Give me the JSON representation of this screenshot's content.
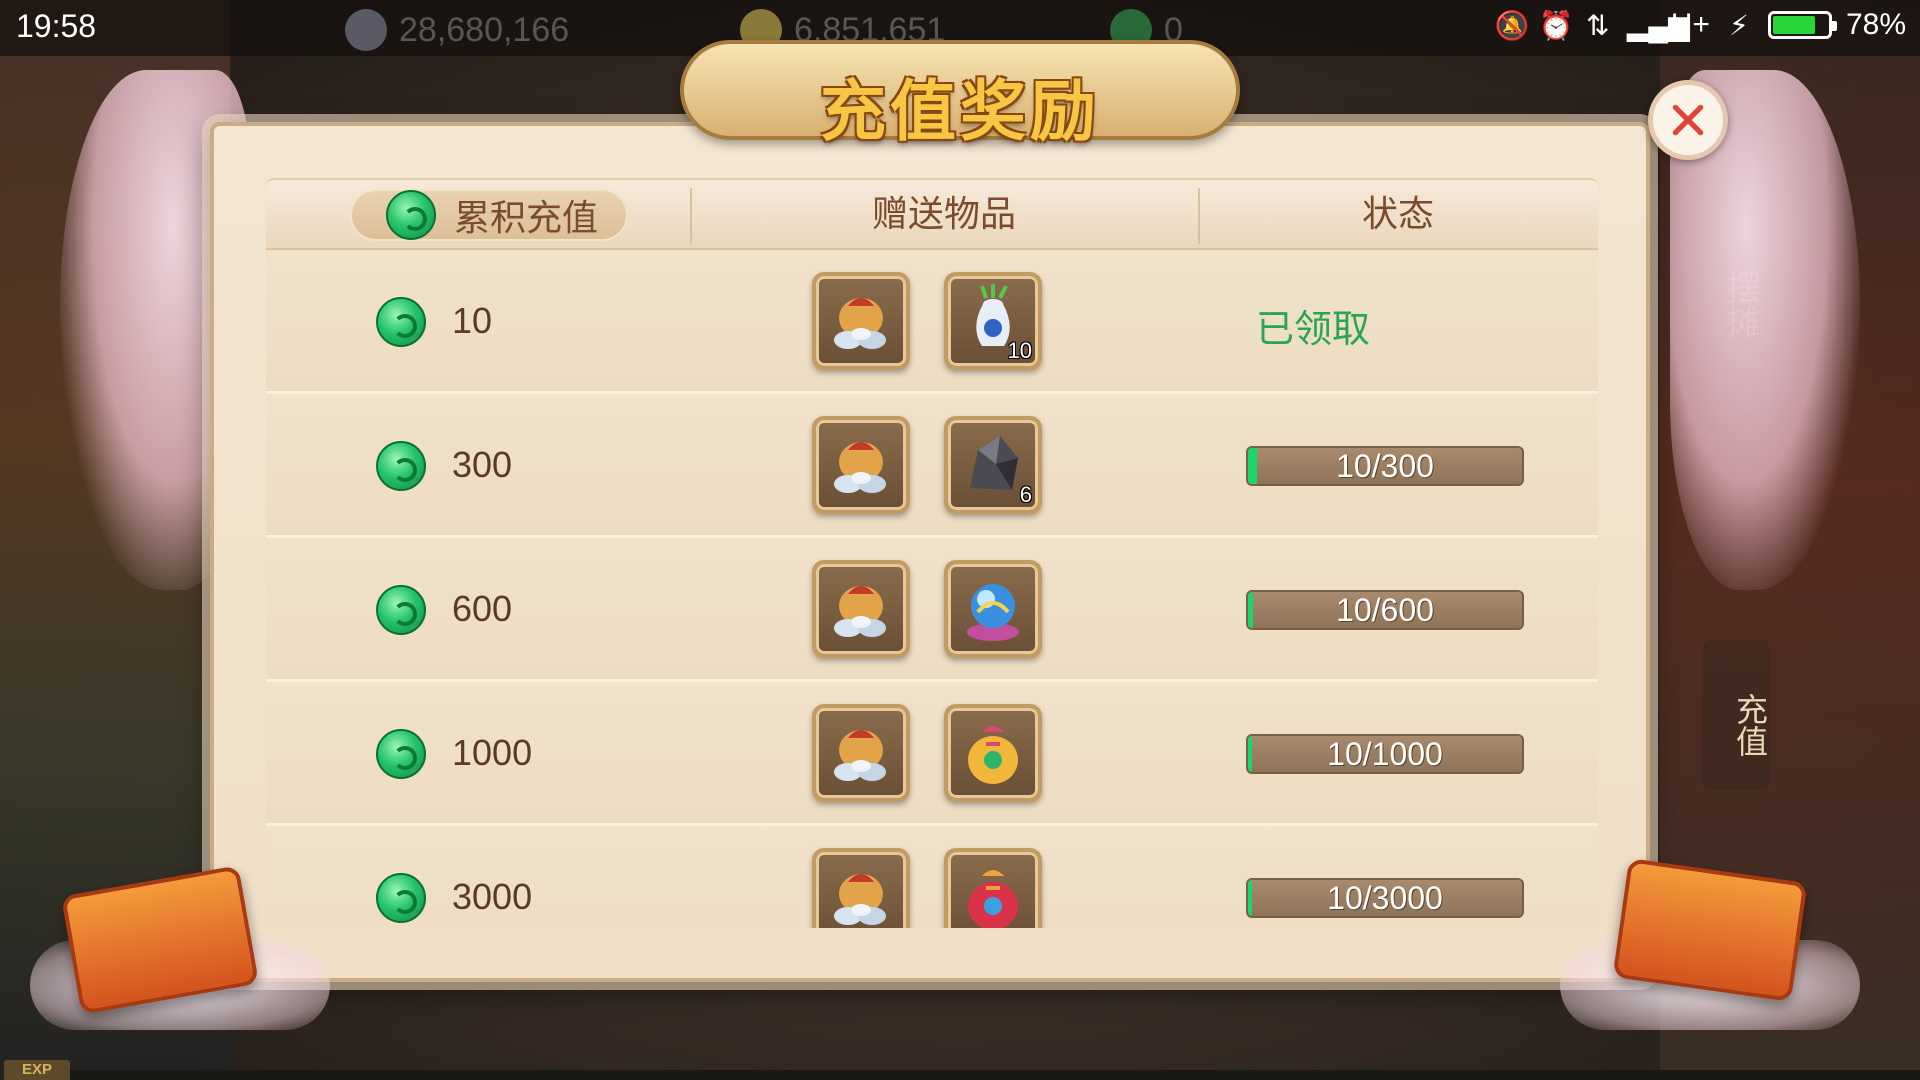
{
  "status_bar": {
    "time": "19:58",
    "resources": [
      {
        "icon": "silver-coin-icon",
        "value": "28,680,166"
      },
      {
        "icon": "gold-ingot-icon",
        "value": "6,851,651"
      },
      {
        "icon": "jade-coin-icon",
        "value": "0"
      }
    ],
    "network": "H+",
    "battery": "78%",
    "battery_level": 0.78,
    "battery_color": "#29d63a"
  },
  "dialog": {
    "title": "充值奖励",
    "close_icon": "close-icon",
    "headers": {
      "recharge": "累积充值",
      "gifts": "赠送物品",
      "status": "状态"
    },
    "rows": [
      {
        "amount": "10",
        "items": [
          {
            "icon": "silver-pouch-icon",
            "count": ""
          },
          {
            "icon": "herb-vase-icon",
            "count": "10"
          }
        ],
        "status_text": "已领取",
        "claimed": true,
        "progress": 1.0
      },
      {
        "amount": "300",
        "items": [
          {
            "icon": "silver-pouch-icon",
            "count": ""
          },
          {
            "icon": "dark-ore-icon",
            "count": "6"
          }
        ],
        "status_text": "10/300",
        "claimed": false,
        "progress": 0.033
      },
      {
        "amount": "600",
        "items": [
          {
            "icon": "silver-pouch-icon",
            "count": ""
          },
          {
            "icon": "crystal-orb-icon",
            "count": ""
          }
        ],
        "status_text": "10/600",
        "claimed": false,
        "progress": 0.017
      },
      {
        "amount": "1000",
        "items": [
          {
            "icon": "silver-pouch-icon",
            "count": ""
          },
          {
            "icon": "gold-bag-icon",
            "count": ""
          }
        ],
        "status_text": "10/1000",
        "claimed": false,
        "progress": 0.01
      },
      {
        "amount": "3000",
        "items": [
          {
            "icon": "silver-pouch-icon",
            "count": ""
          },
          {
            "icon": "red-bag-icon",
            "count": ""
          }
        ],
        "status_text": "10/3000",
        "claimed": false,
        "progress": 0.003
      }
    ]
  },
  "background": {
    "side_text": "摆摊",
    "side_button": "充值",
    "exp_label": "EXP"
  },
  "colors": {
    "claimed": "#2aa653",
    "progress_fill": "#1bd66a",
    "title": "#f7c744"
  }
}
